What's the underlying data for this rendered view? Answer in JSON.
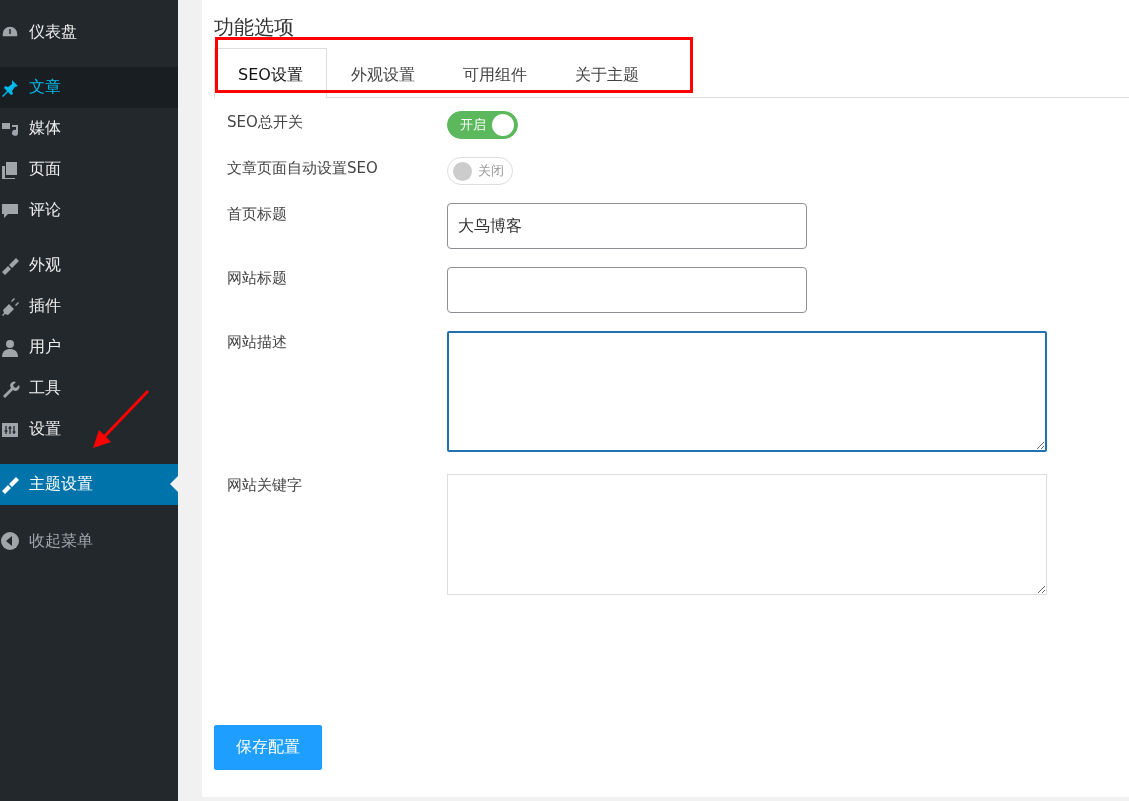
{
  "sidebar": {
    "groups": [
      {
        "items": [
          {
            "label": "仪表盘",
            "selected": false,
            "hovered": false
          }
        ]
      },
      {
        "items": [
          {
            "label": "文章",
            "selected": false,
            "hovered": true
          },
          {
            "label": "媒体",
            "selected": false,
            "hovered": false
          },
          {
            "label": "页面",
            "selected": false,
            "hovered": false
          },
          {
            "label": "评论",
            "selected": false,
            "hovered": false
          }
        ]
      },
      {
        "items": [
          {
            "label": "外观",
            "selected": false,
            "hovered": false
          },
          {
            "label": "插件",
            "selected": false,
            "hovered": false
          },
          {
            "label": "用户",
            "selected": false,
            "hovered": false
          },
          {
            "label": "工具",
            "selected": false,
            "hovered": false
          },
          {
            "label": "设置",
            "selected": false,
            "hovered": false
          }
        ]
      },
      {
        "items": [
          {
            "label": "主题设置",
            "selected": true,
            "hovered": false
          }
        ]
      }
    ],
    "collapse": {
      "label": "收起菜单"
    }
  },
  "panel": {
    "title": "功能选项",
    "tabs": [
      {
        "label": "SEO设置",
        "selected": true
      },
      {
        "label": "外观设置",
        "selected": false
      },
      {
        "label": "可用组件",
        "selected": false
      },
      {
        "label": "关于主题",
        "selected": false
      }
    ],
    "fields": [
      {
        "kind": "switch",
        "label": "SEO总开关",
        "on": true,
        "state_label": "开启"
      },
      {
        "kind": "switch",
        "label": "文章页面自动设置SEO",
        "on": false,
        "state_label": "关闭"
      },
      {
        "kind": "text",
        "label": "首页标题",
        "value": "大鸟博客"
      },
      {
        "kind": "text",
        "label": "网站标题"
      },
      {
        "kind": "textarea",
        "label": "网站描述",
        "focused": true
      },
      {
        "kind": "textarea",
        "label": "网站关键字",
        "focused": false
      }
    ],
    "save_button": "保存配置"
  }
}
